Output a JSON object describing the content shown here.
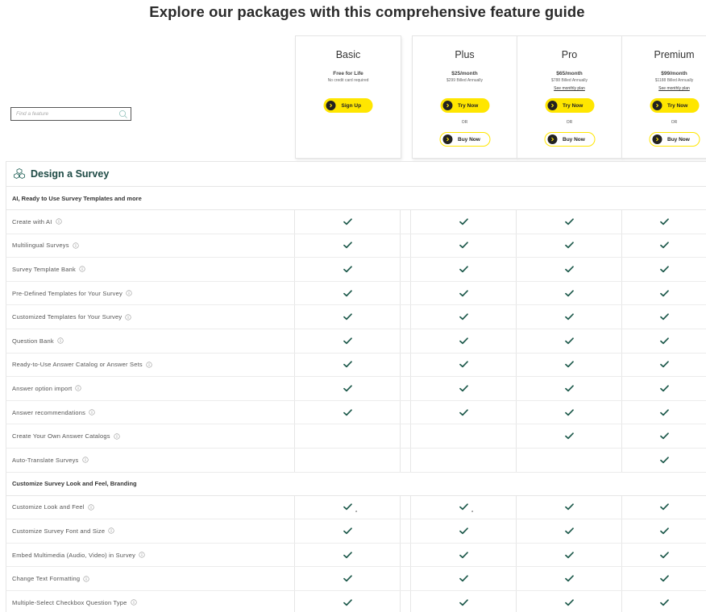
{
  "page_title": "Explore our packages with this comprehensive feature guide",
  "search": {
    "placeholder": "Find a feature"
  },
  "plans": [
    {
      "name": "Basic",
      "price": "Free for Life",
      "sub": "No credit card required",
      "link": "",
      "primary_label": "Sign Up",
      "or_label": "",
      "secondary_label": ""
    },
    {
      "name": "Plus",
      "price": "$25/month",
      "sub": "$299 Billed Annually",
      "link": "",
      "primary_label": "Try Now",
      "or_label": "OR",
      "secondary_label": "Buy Now"
    },
    {
      "name": "Pro",
      "price": "$65/month",
      "sub": "$788 Billed Annually",
      "link": "See monthly plan",
      "primary_label": "Try Now",
      "or_label": "OR",
      "secondary_label": "Buy Now"
    },
    {
      "name": "Premium",
      "price": "$99/month",
      "sub": "$1188 Billed Annually",
      "link": "See monthly plan",
      "primary_label": "Try Now",
      "or_label": "OR",
      "secondary_label": "Buy Now"
    }
  ],
  "section": {
    "title": "Design a Survey",
    "icon": "cubes-icon",
    "groups": [
      {
        "title": "AI, Ready to Use Survey Templates and more",
        "features": [
          {
            "label": "Create with AI",
            "checks": [
              true,
              true,
              true,
              true
            ],
            "notes": [
              "",
              "",
              "",
              ""
            ]
          },
          {
            "label": "Multilingual Surveys",
            "checks": [
              true,
              true,
              true,
              true
            ],
            "notes": [
              "",
              "",
              "",
              ""
            ]
          },
          {
            "label": "Survey Template Bank",
            "checks": [
              true,
              true,
              true,
              true
            ],
            "notes": [
              "",
              "",
              "",
              ""
            ]
          },
          {
            "label": "Pre-Defined Templates for Your Survey",
            "checks": [
              true,
              true,
              true,
              true
            ],
            "notes": [
              "",
              "",
              "",
              ""
            ]
          },
          {
            "label": "Customized Templates for Your Survey",
            "checks": [
              true,
              true,
              true,
              true
            ],
            "notes": [
              "",
              "",
              "",
              ""
            ]
          },
          {
            "label": "Question Bank",
            "checks": [
              true,
              true,
              true,
              true
            ],
            "notes": [
              "",
              "",
              "",
              ""
            ]
          },
          {
            "label": "Ready-to-Use Answer Catalog or Answer Sets",
            "checks": [
              true,
              true,
              true,
              true
            ],
            "notes": [
              "",
              "",
              "",
              ""
            ]
          },
          {
            "label": "Answer option import",
            "checks": [
              true,
              true,
              true,
              true
            ],
            "notes": [
              "",
              "",
              "",
              ""
            ]
          },
          {
            "label": "Answer recommendations",
            "checks": [
              true,
              true,
              true,
              true
            ],
            "notes": [
              "",
              "",
              "",
              ""
            ]
          },
          {
            "label": "Create Your Own Answer Catalogs",
            "checks": [
              false,
              false,
              true,
              true
            ],
            "notes": [
              "",
              "",
              "",
              ""
            ]
          },
          {
            "label": "Auto-Translate Surveys",
            "checks": [
              false,
              false,
              false,
              true
            ],
            "notes": [
              "",
              "",
              "",
              ""
            ]
          }
        ]
      },
      {
        "title": "Customize Survey Look and Feel, Branding",
        "features": [
          {
            "label": "Customize Look and Feel",
            "checks": [
              true,
              true,
              true,
              true
            ],
            "notes": [
              "a",
              "a",
              "",
              ""
            ]
          },
          {
            "label": "Customize Survey Font and Size",
            "checks": [
              true,
              true,
              true,
              true
            ],
            "notes": [
              "",
              "",
              "",
              ""
            ]
          },
          {
            "label": "Embed Multimedia (Audio, Video) in Survey",
            "checks": [
              true,
              true,
              true,
              true
            ],
            "notes": [
              "",
              "",
              "",
              ""
            ]
          },
          {
            "label": "Change Text Formatting",
            "checks": [
              true,
              true,
              true,
              true
            ],
            "notes": [
              "",
              "",
              "",
              ""
            ]
          },
          {
            "label": "Multiple-Select Checkbox Question Type",
            "checks": [
              true,
              true,
              true,
              true
            ],
            "notes": [
              "",
              "",
              "",
              ""
            ]
          }
        ]
      }
    ]
  },
  "colors": {
    "accent_yellow": "#ffe600",
    "check_green": "#1e5a4c",
    "section_title": "#1e4a45"
  }
}
